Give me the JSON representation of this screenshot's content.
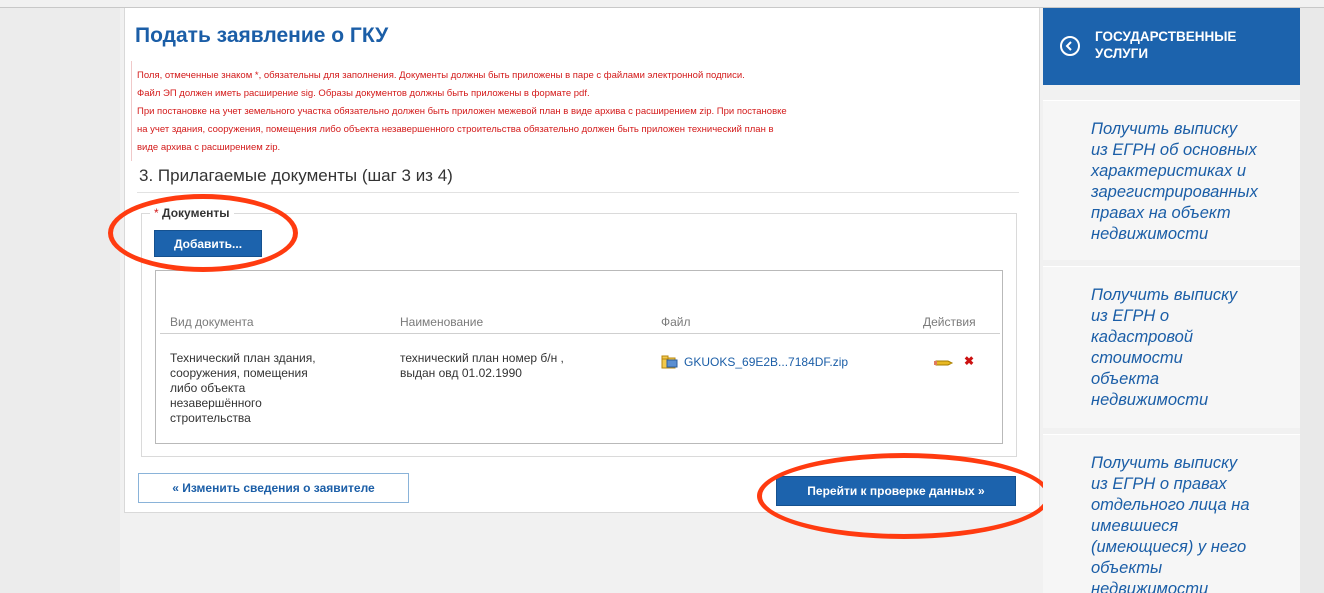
{
  "page": {
    "title": "Подать заявление о ГКУ",
    "notice_lines": [
      "Поля, отмеченные знаком *, обязательны для заполнения. Документы должны быть приложены в паре с файлами электронной подписи.",
      "Файл ЭП должен иметь расширение sig. Образы документов должны быть приложены в формате pdf.",
      "При постановке на учет земельного участка обязательно должен быть приложен межевой план в виде архива с расширением zip. При постановке",
      "на учет здания, сооружения, помещения либо объекта незавершенного строительства обязательно должен быть приложен технический план в",
      "виде архива с расширением zip."
    ],
    "step_title": "3. Прилагаемые документы (шаг 3 из 4)"
  },
  "documents": {
    "required_mark": "*",
    "legend": "Документы",
    "add_button": "Добавить...",
    "headers": {
      "type": "Вид документа",
      "name": "Наименование",
      "file": "Файл",
      "actions": "Действия"
    },
    "rows": [
      {
        "type_lines": [
          "Технический план здания,",
          "сооружения, помещения",
          "либо объекта",
          "незавершённого",
          "строительства"
        ],
        "name_lines": [
          "технический план номер б/н ,",
          "выдан овд 01.02.1990"
        ],
        "file": "GKUOKS_69E2B...7184DF.zip",
        "edit_icon": "pencil-icon",
        "delete_icon": "delete-x-icon"
      }
    ]
  },
  "navigation": {
    "back_button": "« Изменить сведения о заявителе",
    "next_button": "Перейти к проверке данных »"
  },
  "sidebar": {
    "header_icon": "circle-chevron-left-icon",
    "header_title": "ГОСУДАРСТВЕННЫЕ УСЛУГИ",
    "items": [
      {
        "label_lines": [
          "Получить выписку",
          "из ЕГРН об основных",
          "характеристиках и",
          "зарегистрированных",
          "правах на объект",
          "недвижимости"
        ]
      },
      {
        "label_lines": [
          "Получить выписку",
          "из ЕГРН о",
          "кадастровой",
          "стоимости",
          "объекта",
          "недвижимости"
        ]
      },
      {
        "label_lines": [
          "Получить выписку",
          "из ЕГРН о правах",
          "отдельного лица на",
          "имевшиеся",
          "(имеющиеся) у него",
          "объекты",
          "недвижимости"
        ]
      }
    ]
  },
  "colors": {
    "brand_blue": "#1c63ad",
    "notice_red": "#d31a1a",
    "annotation_red": "#ff3b10"
  }
}
